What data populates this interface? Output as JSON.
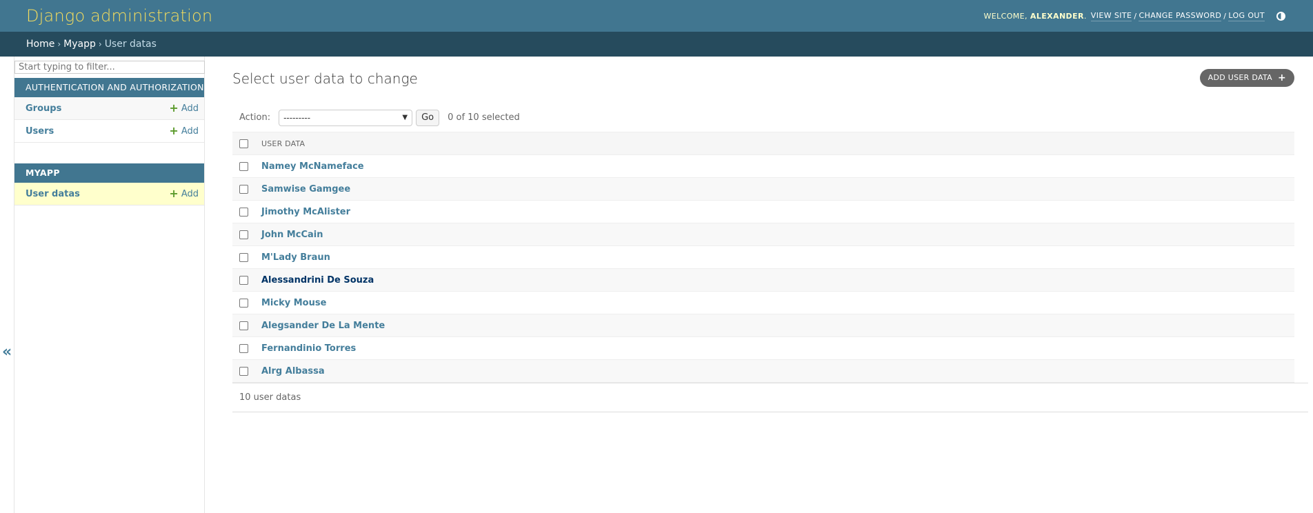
{
  "header": {
    "branding": "Django administration",
    "welcome": "WELCOME,",
    "username": "ALEXANDER",
    "period": ".",
    "view_site": "VIEW SITE",
    "change_password": "CHANGE PASSWORD",
    "log_out": "LOG OUT",
    "separator": "/",
    "theme_icon": "theme-toggle-icon"
  },
  "breadcrumbs": {
    "items": [
      "Home",
      "Myapp",
      "User datas"
    ],
    "separator": "›"
  },
  "sidebar": {
    "filter_placeholder": "Start typing to filter...",
    "modules": [
      {
        "caption": "AUTHENTICATION AND AUTHORIZATION",
        "models": [
          {
            "name": "Groups",
            "add_label": "Add"
          },
          {
            "name": "Users",
            "add_label": "Add"
          }
        ]
      },
      {
        "caption": "MYAPP",
        "models": [
          {
            "name": "User datas",
            "add_label": "Add",
            "current": true
          }
        ]
      }
    ],
    "toggle_nav": "«"
  },
  "main": {
    "title": "Select user data to change",
    "add_button": "ADD USER DATA",
    "actions": {
      "label": "Action:",
      "selected_value": "---------",
      "go_label": "Go",
      "selected_count": "0 of 10 selected"
    },
    "table": {
      "column_header": "USER DATA",
      "rows": [
        "Namey McNameface",
        "Samwise Gamgee",
        "Jimothy McAlister",
        "John McCain",
        "M'Lady Braun",
        "Alessandrini De Souza",
        "Micky Mouse",
        "Alegsander De La Mente",
        "Fernandinio Torres",
        "Alrg Albassa"
      ],
      "hovered_row": "Alessandrini De Souza"
    },
    "paginator": "10 user datas"
  },
  "colors": {
    "header_bg": "#417690",
    "breadcrumbs_bg": "#264b5d",
    "branding": "#f5dd5d",
    "link": "#447e9b",
    "current_row_bg": "#ffffcc",
    "add_plus": "#5b9a2b"
  }
}
